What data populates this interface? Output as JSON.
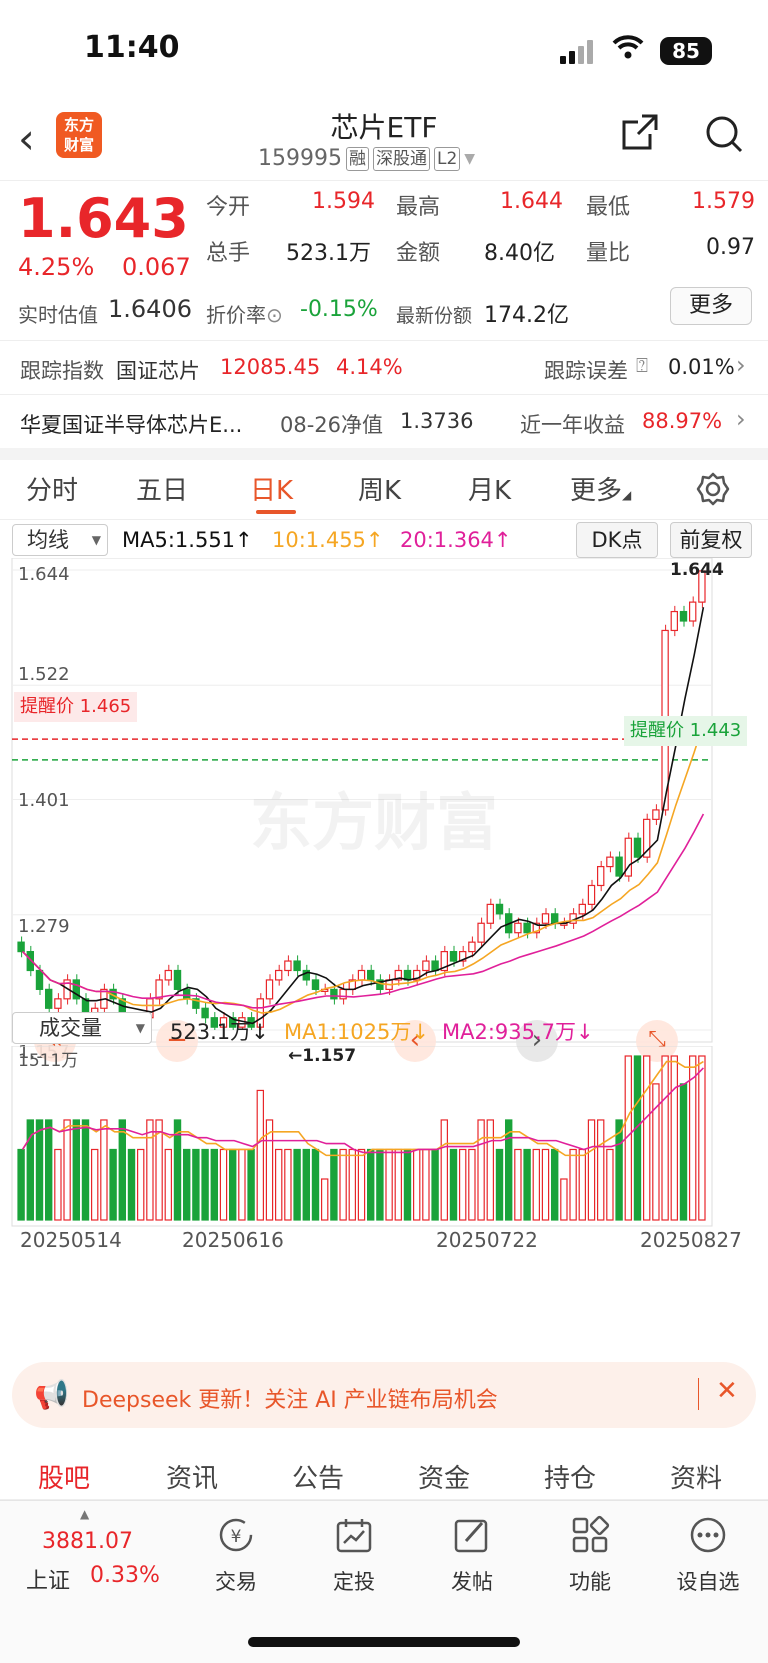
{
  "status": {
    "time": "11:40",
    "battery": "85"
  },
  "nav": {
    "logo_text": "东方\n财富",
    "title": "芯片ETF",
    "code": "159995",
    "tags": [
      "融",
      "深股通",
      "L2"
    ]
  },
  "quote": {
    "price": "1.643",
    "change_pct": "4.25%",
    "change": "0.067",
    "estimate_label": "实时估值",
    "estimate_value": "1.6406",
    "open_label": "今开",
    "open": "1.594",
    "high_label": "最高",
    "high": "1.644",
    "low_label": "最低",
    "low": "1.579",
    "volume_label": "总手",
    "volume": "523.1万",
    "amount_label": "金额",
    "amount": "8.40亿",
    "ratio_label": "量比",
    "ratio": "0.97",
    "premium_label": "折价率",
    "premium": "-0.15%",
    "shares_label": "最新份额",
    "shares": "174.2亿",
    "more_label": "更多"
  },
  "tracking": {
    "label": "跟踪指数",
    "index_name": "国证芯片",
    "index_value": "12085.45",
    "index_pct": "4.14%",
    "error_label": "跟踪误差",
    "error_value": "0.01%"
  },
  "fund": {
    "name": "华夏国证半导体芯片E...",
    "nav_label": "08-26净值",
    "nav_value": "1.3736",
    "return_label": "近一年收益",
    "return_value": "88.97%"
  },
  "tabs": [
    "分时",
    "五日",
    "日K",
    "周K",
    "月K",
    "更多"
  ],
  "ma": {
    "selector": "均线",
    "ma5": "MA5:1.551↑",
    "ma10": "10:1.455↑",
    "ma20": "20:1.364↑",
    "dk": "DK点",
    "adjust": "前复权"
  },
  "chart": {
    "y_labels": [
      "1.644",
      "1.522",
      "1.401",
      "1.279",
      "1.157"
    ],
    "alert_upper": "提醒价 1.465",
    "alert_lower": "提醒价 1.443",
    "max_label": "1.644",
    "min_label": "←1.157",
    "watermark": "东方财富"
  },
  "volume": {
    "selector": "成交量",
    "current": "523.1万↓",
    "ma1": "MA1:1025万↓",
    "ma2": "MA2:935.7万↓",
    "max_label": "1511万",
    "dates": [
      "20250514",
      "20250616",
      "20250722",
      "20250827"
    ]
  },
  "banner": {
    "text": "Deepseek 更新！关注 AI 产业链布局机会"
  },
  "bottom_tabs": [
    "股吧",
    "资讯",
    "公告",
    "资金",
    "持仓",
    "资料"
  ],
  "bottom_nav": {
    "index_value": "3881.07",
    "index_name": "上证",
    "index_pct": "0.33%",
    "items": [
      "交易",
      "定投",
      "发帖",
      "功能",
      "设自选"
    ]
  },
  "colors": {
    "up": "#e8262a",
    "down": "#1aa33a",
    "accent": "#e8562a",
    "ma5": "#111111",
    "ma10": "#f5a623",
    "ma20": "#e0209a"
  },
  "chart_data": {
    "type": "candlestick",
    "y_ticks": [
      1.644,
      1.522,
      1.401,
      1.279,
      1.157
    ],
    "ylim": [
      1.157,
      1.644
    ],
    "alert_lines": [
      1.465,
      1.443
    ],
    "x_ticks": [
      "20250514",
      "20250616",
      "20250722",
      "20250827"
    ],
    "closes": [
      1.24,
      1.22,
      1.2,
      1.18,
      1.19,
      1.21,
      1.19,
      1.17,
      1.18,
      1.2,
      1.19,
      1.17,
      1.16,
      1.17,
      1.19,
      1.21,
      1.22,
      1.2,
      1.19,
      1.18,
      1.17,
      1.16,
      1.17,
      1.16,
      1.17,
      1.16,
      1.19,
      1.21,
      1.22,
      1.23,
      1.22,
      1.21,
      1.2,
      1.2,
      1.19,
      1.2,
      1.21,
      1.22,
      1.21,
      1.2,
      1.21,
      1.22,
      1.21,
      1.22,
      1.23,
      1.22,
      1.24,
      1.23,
      1.24,
      1.25,
      1.27,
      1.29,
      1.28,
      1.26,
      1.27,
      1.26,
      1.27,
      1.28,
      1.27,
      1.27,
      1.28,
      1.29,
      1.31,
      1.33,
      1.34,
      1.32,
      1.36,
      1.34,
      1.38,
      1.39,
      1.58,
      1.6,
      1.59,
      1.61,
      1.643
    ],
    "volume_ma": [
      1025,
      935.7
    ]
  }
}
